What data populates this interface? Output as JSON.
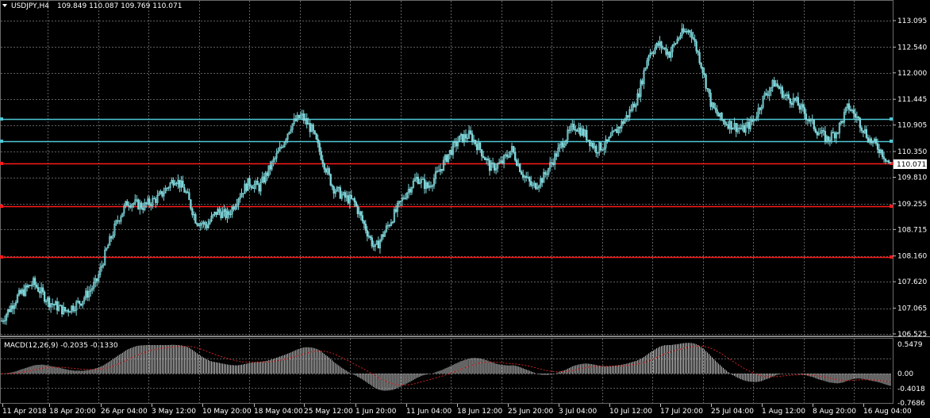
{
  "title": {
    "symbol": "USDJPY,H4",
    "ohlc": "109.849 110.087 109.769 110.071"
  },
  "price_scale": {
    "labels": [
      "113.095",
      "112.540",
      "112.000",
      "111.445",
      "110.905",
      "110.350",
      "109.810",
      "109.255",
      "108.715",
      "108.160",
      "107.620",
      "107.065",
      "106.525"
    ],
    "current_price": "110.071"
  },
  "macd": {
    "label": "MACD(12,26,9) -0.2035 -0.1330",
    "scale_labels": [
      "0.5479",
      "0.00",
      "-0.4018",
      "-0.7686"
    ]
  },
  "time_axis": {
    "labels": [
      "11 Apr 2018",
      "18 Apr 20:00",
      "26 Apr 04:00",
      "3 May 12:00",
      "10 May 20:00",
      "18 May 04:00",
      "25 May 12:00",
      "1 Jun 20:00",
      "11 Jun 04:00",
      "18 Jun 12:00",
      "25 Jun 20:00",
      "3 Jul 04:00",
      "10 Jul 12:00",
      "17 Jul 20:00",
      "25 Jul 04:00",
      "1 Aug 12:00",
      "8 Aug 20:00",
      "16 Aug 04:00"
    ]
  },
  "colors": {
    "background": "#000000",
    "grid": "#5f5f5f",
    "candles": "#7fd8dc",
    "support_line": "#ff1a1a",
    "resistance_line": "#4fc7d6",
    "macd_histogram": "#c8c8c8",
    "macd_signal": "#d22222"
  },
  "chart_data": {
    "type": "candlestick",
    "price_range": [
      106.525,
      113.095
    ],
    "close_path": [
      [
        0,
        106.8
      ],
      [
        3,
        107.3
      ],
      [
        6,
        107.6
      ],
      [
        9,
        107.2
      ],
      [
        12,
        107.0
      ],
      [
        15,
        107.2
      ],
      [
        18,
        107.6
      ],
      [
        20,
        108.3
      ],
      [
        22,
        108.9
      ],
      [
        24,
        109.3
      ],
      [
        27,
        109.2
      ],
      [
        30,
        109.4
      ],
      [
        33,
        109.8
      ],
      [
        35,
        109.5
      ],
      [
        37,
        108.9
      ],
      [
        39,
        108.8
      ],
      [
        41,
        109.1
      ],
      [
        43,
        109.0
      ],
      [
        45,
        109.4
      ],
      [
        47,
        109.7
      ],
      [
        49,
        109.6
      ],
      [
        51,
        110.0
      ],
      [
        53,
        110.4
      ],
      [
        55,
        110.9
      ],
      [
        57,
        111.1
      ],
      [
        59,
        110.8
      ],
      [
        61,
        110.2
      ],
      [
        63,
        109.6
      ],
      [
        65,
        109.4
      ],
      [
        67,
        109.3
      ],
      [
        69,
        108.8
      ],
      [
        71,
        108.3
      ],
      [
        73,
        108.7
      ],
      [
        75,
        109.1
      ],
      [
        77,
        109.5
      ],
      [
        79,
        109.8
      ],
      [
        81,
        109.6
      ],
      [
        83,
        109.9
      ],
      [
        85,
        110.3
      ],
      [
        87,
        110.6
      ],
      [
        89,
        110.7
      ],
      [
        91,
        110.4
      ],
      [
        93,
        110.0
      ],
      [
        95,
        110.1
      ],
      [
        97,
        110.4
      ],
      [
        99,
        109.9
      ],
      [
        101,
        109.6
      ],
      [
        103,
        109.8
      ],
      [
        105,
        110.2
      ],
      [
        107,
        110.6
      ],
      [
        109,
        110.9
      ],
      [
        111,
        110.7
      ],
      [
        113,
        110.4
      ],
      [
        115,
        110.5
      ],
      [
        117,
        110.8
      ],
      [
        119,
        111.1
      ],
      [
        121,
        111.5
      ],
      [
        123,
        112.4
      ],
      [
        125,
        112.6
      ],
      [
        127,
        112.4
      ],
      [
        129,
        112.8
      ],
      [
        131,
        112.9
      ],
      [
        133,
        112.2
      ],
      [
        135,
        111.3
      ],
      [
        137,
        111.0
      ],
      [
        139,
        110.9
      ],
      [
        141,
        110.8
      ],
      [
        143,
        111.0
      ],
      [
        145,
        111.5
      ],
      [
        147,
        111.8
      ],
      [
        149,
        111.5
      ],
      [
        151,
        111.4
      ],
      [
        153,
        111.1
      ],
      [
        155,
        110.8
      ],
      [
        157,
        110.6
      ],
      [
        159,
        110.8
      ],
      [
        161,
        111.3
      ],
      [
        163,
        111.0
      ],
      [
        165,
        110.6
      ],
      [
        167,
        110.4
      ],
      [
        169,
        110.07
      ]
    ]
  }
}
